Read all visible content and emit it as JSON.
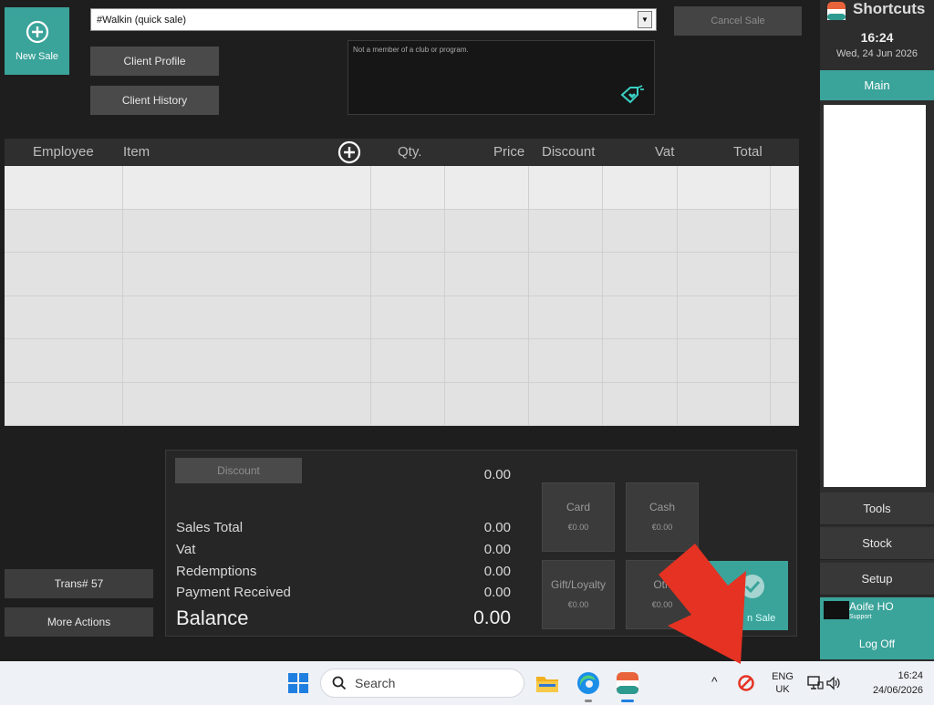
{
  "new_sale": {
    "label": "New Sale"
  },
  "client": {
    "select_value": "#Walkin (quick sale)",
    "profile_label": "Client Profile",
    "history_label": "Client History",
    "membership_note": "Not a member of a club or program."
  },
  "cancel_sale_label": "Cancel Sale",
  "table": {
    "columns": [
      "Employee",
      "Item",
      "Qty.",
      "Price",
      "Discount",
      "Vat",
      "Total"
    ]
  },
  "totals": {
    "discount_label": "Discount",
    "discount_value": "0.00",
    "sales_total_label": "Sales Total",
    "sales_total_value": "0.00",
    "vat_label": "Vat",
    "vat_value": "0.00",
    "redemptions_label": "Redemptions",
    "redemptions_value": "0.00",
    "payment_received_label": "Payment Received",
    "payment_received_value": "0.00",
    "balance_label": "Balance",
    "balance_value": "0.00"
  },
  "payments": {
    "card_label": "Card",
    "card_amount": "€0.00",
    "cash_label": "Cash",
    "cash_amount": "€0.00",
    "gift_label": "Gift/Loyalty",
    "gift_amount": "€0.00",
    "other_label": "Oth",
    "other_amount": "€0.00",
    "finish_label": "n Sale"
  },
  "left_actions": {
    "trans_label": "Trans# 57",
    "more_label": "More Actions"
  },
  "sidebar": {
    "title": "Shortcuts",
    "time": "16:24",
    "date": "Wed, 24 Jun 2026",
    "main_label": "Main",
    "tools_label": "Tools",
    "stock_label": "Stock",
    "setup_label": "Setup",
    "user_name": "Aoife HO",
    "user_role": "Support",
    "logoff_label": "Log Off"
  },
  "taskbar": {
    "search_placeholder": "Search",
    "lang_top": "ENG",
    "lang_bottom": "UK",
    "clock_time": "16:24",
    "clock_date": "24/06/2026"
  },
  "colors": {
    "accent": "#3aa39a",
    "arrow": "#e53222"
  }
}
